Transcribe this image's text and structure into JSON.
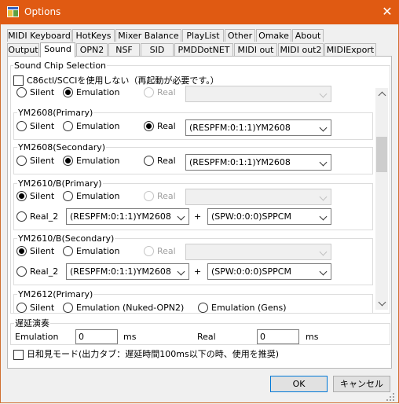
{
  "window": {
    "title": "Options",
    "accent": "#e05a12"
  },
  "tabs_row1": [
    "MIDI Keyboard",
    "HotKeys",
    "Mixer Balance",
    "PlayList",
    "Other",
    "Omake",
    "About"
  ],
  "tabs_row2": [
    "Output",
    "Sound",
    "OPN2",
    "NSF",
    "SID",
    "PMDDotNET",
    "MIDI out",
    "MIDI out2",
    "MIDIExport"
  ],
  "selected_tab": "Sound",
  "panel": {
    "group_title": "Sound Chip Selection",
    "c86_checkbox": "C86ctl/SCCIを使用しない（再起動が必要です。）",
    "top_row": {
      "silent": "Silent",
      "emulation": "Emulation",
      "real": "Real"
    },
    "ym2608_primary": {
      "title": "YM2608(Primary)",
      "silent": "Silent",
      "emulation": "Emulation",
      "real": "Real",
      "combo": "(RESPFM:0:1:1)YM2608"
    },
    "ym2608_secondary": {
      "title": "YM2608(Secondary)",
      "silent": "Silent",
      "emulation": "Emulation",
      "real": "Real",
      "combo": "(RESPFM:0:1:1)YM2608"
    },
    "ym2610b_primary": {
      "title": "YM2610/B(Primary)",
      "silent": "Silent",
      "emulation": "Emulation",
      "real": "Real",
      "real2": "Real_2",
      "combo_a": "(RESPFM:0:1:1)YM2608",
      "plus": "+",
      "combo_b": "(SPW:0:0:0)SPPCM"
    },
    "ym2610b_secondary": {
      "title": "YM2610/B(Secondary)",
      "silent": "Silent",
      "emulation": "Emulation",
      "real": "Real",
      "real2": "Real_2",
      "combo_a": "(RESPFM:0:1:1)YM2608",
      "plus": "+",
      "combo_b": "(SPW:0:0:0)SPPCM"
    },
    "ym2612_primary": {
      "title": "YM2612(Primary)",
      "silent": "Silent",
      "emulation_nuked": "Emulation (Nuked-OPN2)",
      "emulation_gens": "Emulation (Gens)"
    },
    "latency": {
      "title": "遅延演奏",
      "emulation_label": "Emulation",
      "emulation_value": "0",
      "emulation_unit": "ms",
      "real_label": "Real",
      "real_value": "0",
      "real_unit": "ms"
    },
    "hiyorimi_checkbox": "日和見モード(出力タブ：遅延時間100ms以下の時、使用を推奨)"
  },
  "buttons": {
    "ok": "OK",
    "cancel": "キャンセル"
  }
}
